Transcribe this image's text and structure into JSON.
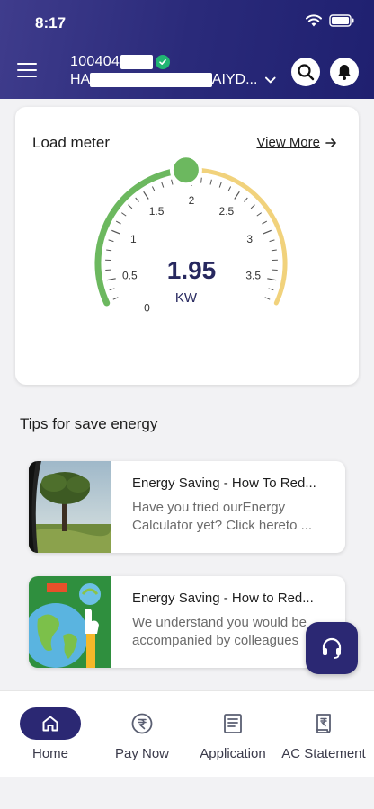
{
  "status_bar": {
    "time": "8:17"
  },
  "header": {
    "account_number": "100404",
    "account_name_start": "HA",
    "account_name_end": "AIYD...",
    "menu_icon": "hamburger-icon",
    "search_icon": "search-icon",
    "notification_icon": "bell-icon"
  },
  "load_meter": {
    "title": "Load meter",
    "view_more": "View More",
    "value": "1.95",
    "unit": "KW",
    "reading": 1.95,
    "scale_min": 0,
    "scale_max": 4,
    "scale_labels": [
      "0",
      "0.5",
      "1",
      "1.5",
      "2",
      "2.5",
      "3",
      "3.5"
    ],
    "colors": {
      "active": "#6cb85f",
      "inactive": "#f1d27c",
      "value": "#27285f"
    }
  },
  "tips": {
    "section_title": "Tips for save energy",
    "items": [
      {
        "title": "Energy Saving - How To Red...",
        "body": "Have you tried ourEnergy Calculator yet? Click hereto ..."
      },
      {
        "title": "Energy Saving - How to Red...",
        "body": "We understand you would be accompanied by colleagues"
      }
    ]
  },
  "support_icon": "headset-icon",
  "nav": {
    "items": [
      {
        "label": "Home",
        "icon": "home-icon",
        "active": true
      },
      {
        "label": "Pay Now",
        "icon": "rupee-icon",
        "active": false
      },
      {
        "label": "Application",
        "icon": "document-icon",
        "active": false
      },
      {
        "label": "AC Statement",
        "icon": "statement-icon",
        "active": false
      }
    ],
    "active_color": "#2b2873"
  }
}
